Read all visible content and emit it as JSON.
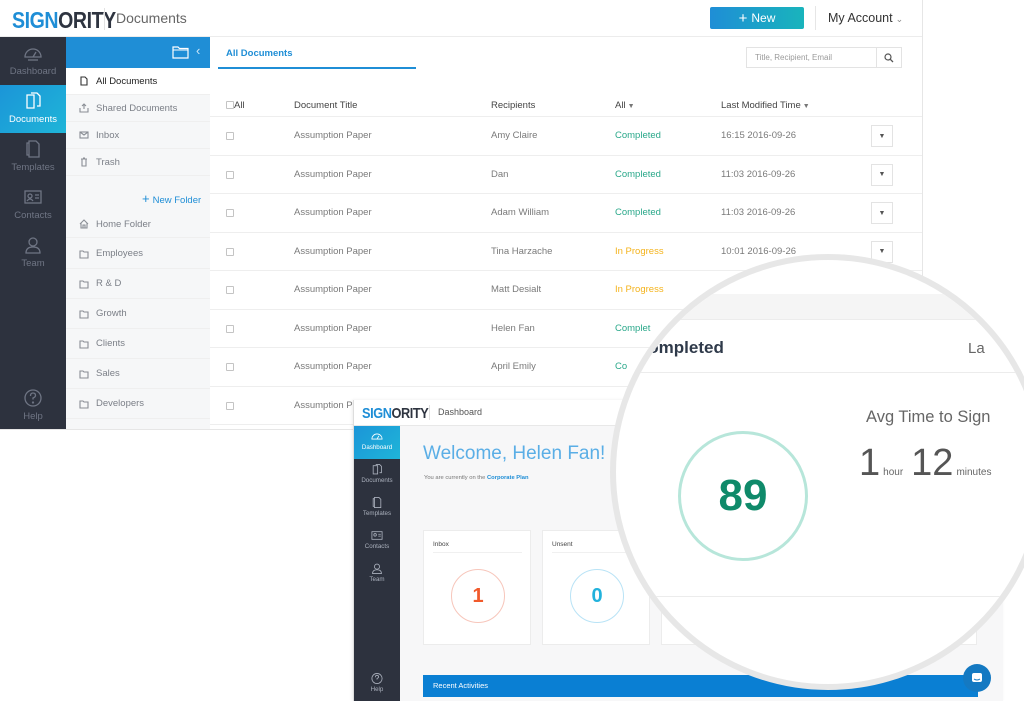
{
  "brand": {
    "logo_part1": "SIGN",
    "logo_part2": "ORITY",
    "accent": "#1f8ed6",
    "nav_dark": "#2d323e"
  },
  "documents_window": {
    "page_title": "Documents",
    "header": {
      "new_label": "New",
      "account_label": "My Account"
    },
    "nav": [
      {
        "icon": "dashboard-gauge-icon",
        "label": "Dashboard",
        "active": false
      },
      {
        "icon": "documents-icon",
        "label": "Documents",
        "active": true
      },
      {
        "icon": "templates-icon",
        "label": "Templates",
        "active": false
      },
      {
        "icon": "contacts-card-icon",
        "label": "Contacts",
        "active": false
      },
      {
        "icon": "team-person-icon",
        "label": "Team",
        "active": false
      },
      {
        "icon": "help-question-icon",
        "label": "Help",
        "active": false
      }
    ],
    "folders_panel": {
      "items": [
        {
          "icon": "file-icon",
          "label": "All Documents",
          "selected": true
        },
        {
          "icon": "share-icon",
          "label": "Shared Documents",
          "selected": false
        },
        {
          "icon": "mail-icon",
          "label": "Inbox",
          "selected": false
        },
        {
          "icon": "trash-icon",
          "label": "Trash",
          "selected": false
        }
      ],
      "new_folder_label": "New Folder",
      "home_folder_label": "Home Folder",
      "folders": [
        "Employees",
        "R & D",
        "Growth",
        "Clients",
        "Sales",
        "Developers"
      ]
    },
    "tab_label": "All Documents",
    "search": {
      "placeholder": "Title, Recipient, Email",
      "value": ""
    },
    "table": {
      "headers": {
        "select_all": "All",
        "title": "Document Title",
        "recipients": "Recipients",
        "status_filter": "All",
        "modified": "Last Modified Time"
      },
      "rows": [
        {
          "title": "Assumption Paper",
          "recipient": "Amy Claire",
          "status": "Completed",
          "modified": "16:15 2016-09-26"
        },
        {
          "title": "Assumption Paper",
          "recipient": "Dan",
          "status": "Completed",
          "modified": "11:03 2016-09-26"
        },
        {
          "title": "Assumption Paper",
          "recipient": "Adam William",
          "status": "Completed",
          "modified": "11:03 2016-09-26"
        },
        {
          "title": "Assumption Paper",
          "recipient": "Tina Harzache",
          "status": "In Progress",
          "modified": "10:01 2016-09-26"
        },
        {
          "title": "Assumption Paper",
          "recipient": "Matt Desialt",
          "status": "In Progress",
          "modified": ""
        },
        {
          "title": "Assumption Paper",
          "recipient": "Helen Fan",
          "status": "Complet",
          "modified": ""
        },
        {
          "title": "Assumption Paper",
          "recipient": "April Emily",
          "status": "Co",
          "modified": ""
        },
        {
          "title": "Assumption Paper",
          "recipient": "",
          "status": "",
          "modified": ""
        }
      ],
      "status_colors": {
        "Completed": "#2aa88a",
        "In Progress": "#f4b31c"
      }
    }
  },
  "dashboard_window": {
    "page_title": "Dashboard",
    "nav": [
      {
        "icon": "dashboard-gauge-icon",
        "label": "Dashboard",
        "active": true
      },
      {
        "icon": "documents-icon",
        "label": "Documents",
        "active": false
      },
      {
        "icon": "templates-icon",
        "label": "Templates",
        "active": false
      },
      {
        "icon": "contacts-card-icon",
        "label": "Contacts",
        "active": false
      },
      {
        "icon": "team-person-icon",
        "label": "Team",
        "active": false
      },
      {
        "icon": "help-question-icon",
        "label": "Help",
        "active": false
      }
    ],
    "welcome": "Welcome, Helen Fan!",
    "plan_prefix": "You are currently on the",
    "plan_link": "Corporate Plan",
    "cards": [
      {
        "label": "Inbox",
        "value": "1",
        "color": "#f15a2b"
      },
      {
        "label": "Unsent",
        "value": "0",
        "color": "#22b2dc"
      }
    ],
    "recent_activities_label": "Recent Activities"
  },
  "magnifier": {
    "heading": "Completed",
    "last_partial": "La",
    "completed_count": "89",
    "avg_label": "Avg Time to Sign",
    "avg_hours": "1",
    "hours_unit": "hour",
    "avg_minutes": "12",
    "minutes_unit": "minutes"
  }
}
